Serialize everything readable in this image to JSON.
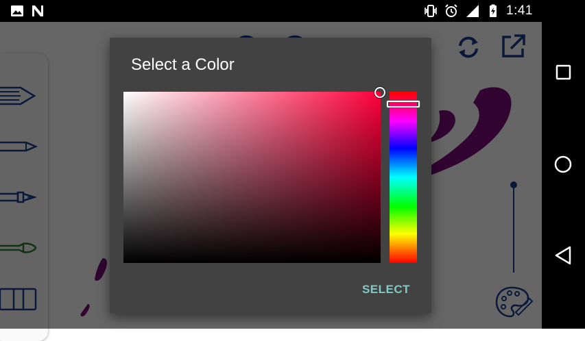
{
  "status_bar": {
    "time": "1:41",
    "icons_left": [
      "image-icon",
      "n-icon"
    ],
    "icons_right": [
      "vibrate-icon",
      "alarm-icon",
      "signal-icon",
      "battery-charging-icon"
    ]
  },
  "dialog": {
    "title": "Select a Color",
    "select_label": "SELECT",
    "selected_hue": "#ff003a",
    "hue_position": 0.07,
    "saturation": 1.0,
    "value": 1.0
  },
  "toolbar": {
    "icons": [
      "undo-icon",
      "redo-icon",
      "refresh-icon",
      "open-external-icon",
      "palette-icon"
    ]
  },
  "tools": [
    "marker-tool",
    "pencil-tool",
    "fountain-pen-tool",
    "brush-tool",
    "eraser-tool"
  ],
  "nav_bar": {
    "buttons": [
      "recents-button",
      "home-button",
      "back-button"
    ]
  },
  "colors": {
    "accent": "#80cbc4",
    "dialog_bg": "#424242",
    "tool_blue": "#1a3d8f",
    "brush_green": "#2e7d32",
    "stroke_purple": "#7b0a7b"
  }
}
